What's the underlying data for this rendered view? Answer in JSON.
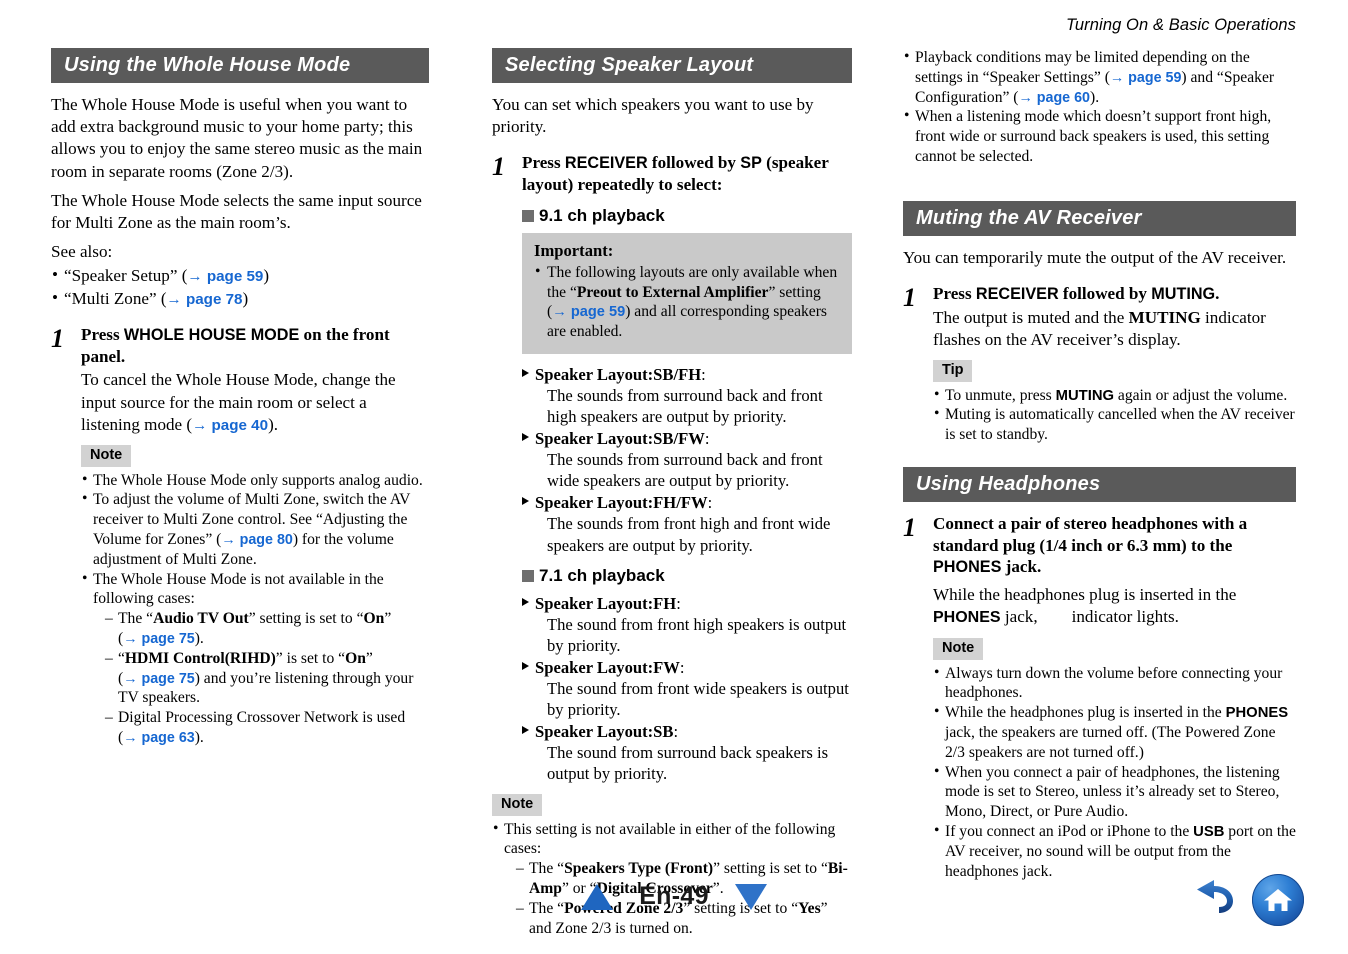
{
  "running_header": "Turning On & Basic Operations",
  "col1": {
    "section_title": "Using the Whole House Mode",
    "intro1": "The Whole House Mode is useful when you want to add extra background music to your home party; this allows you to enjoy the same stereo music as the main room in separate rooms (Zone 2/3).",
    "intro2": "The Whole House Mode selects the same input source for Multi Zone as the main room’s.",
    "see_also_label": "See also:",
    "see_also": [
      {
        "pre": "“Speaker Setup” (",
        "link": "→ page 59",
        "post": ")"
      },
      {
        "pre": "“Multi Zone” (",
        "link": "→ page 78",
        "post": ")"
      }
    ],
    "step": {
      "num": "1",
      "title_pre": "Press ",
      "title_caps": "WHOLE HOUSE MODE",
      "title_post": " on the front panel.",
      "desc_pre": "To cancel the Whole House Mode, change the input source for the main room or select a listening mode (",
      "desc_link": "→ page 40",
      "desc_post": ")."
    },
    "note_badge": "Note",
    "notes": {
      "n1": "The Whole House Mode only supports analog audio.",
      "n2_a": "To adjust the volume of Multi Zone, switch the AV receiver to Multi Zone control. See “Adjusting the Volume for Zones” (",
      "n2_link": "→ page 80",
      "n2_b": ") for the volume adjustment of Multi Zone.",
      "n3": "The Whole House Mode is not available in the following cases:",
      "sub1_a": "The “",
      "sub1_b": "Audio TV Out",
      "sub1_c": "” setting is set to “",
      "sub1_d": "On",
      "sub1_e": "” (",
      "sub1_link": "→ page 75",
      "sub1_f": ").",
      "sub2_a": "“",
      "sub2_b": "HDMI Control(RIHD)",
      "sub2_c": "” is set to “",
      "sub2_d": "On",
      "sub2_e": "” (",
      "sub2_link": "→ page 75",
      "sub2_f": ") and you’re listening through your TV speakers.",
      "sub3_a": "Digital Processing Crossover Network is used (",
      "sub3_link": "→ page 63",
      "sub3_b": ")."
    }
  },
  "col2": {
    "section_title": "Selecting Speaker Layout",
    "intro": "You can set which speakers you want to use by priority.",
    "step": {
      "num": "1",
      "t1": "Press ",
      "t2": "RECEIVER",
      "t3": " followed by ",
      "t4": "SP",
      "t5": " (speaker layout) repeatedly to select:"
    },
    "head_91": "9.1 ch playback",
    "head_71": "7.1 ch playback",
    "important": {
      "title": "Important:",
      "body_a": "The following layouts are only available when the “",
      "body_b": "Preout to External Amplifier",
      "body_c": "” setting (",
      "link": "→ page 59",
      "body_d": ") and all corresponding speakers are enabled."
    },
    "layouts_91": [
      {
        "head": "Speaker Layout:SB/FH",
        "colon": ":",
        "desc": "The sounds from surround back and front high speakers are output by priority."
      },
      {
        "head": "Speaker Layout:SB/FW",
        "colon": ":",
        "desc": "The sounds from surround back and front wide speakers are output by priority."
      },
      {
        "head": "Speaker Layout:FH/FW",
        "colon": ":",
        "desc": "The sounds from front high and front wide speakers are output by priority."
      }
    ],
    "layouts_71": [
      {
        "head": "Speaker Layout:FH",
        "colon": ":",
        "desc": "The sound from front high speakers is output by priority."
      },
      {
        "head": "Speaker Layout:FW",
        "colon": ":",
        "desc": "The sound from front wide speakers is output by priority."
      },
      {
        "head": "Speaker Layout:SB",
        "colon": ":",
        "desc": "The sound from surround back speakers is output by priority."
      }
    ],
    "note_badge": "Note",
    "note": {
      "n1": "This setting is not available in either of the following cases:",
      "s1_a": "The “",
      "s1_b": "Speakers Type (Front)",
      "s1_c": "” setting is set to “",
      "s1_d": "Bi-Amp",
      "s1_e": "” or “",
      "s1_f": "Digital Crossover",
      "s1_g": "”.",
      "s2_a": "The “",
      "s2_b": "Powered Zone 2/3",
      "s2_c": "” setting is set to “",
      "s2_d": "Yes",
      "s2_e": "” and Zone 2/3 is turned on."
    }
  },
  "col3": {
    "top_notes": {
      "n1_a": "Playback conditions may be limited depending on the settings in “Speaker Settings” (",
      "n1_link1": "→ page 59",
      "n1_b": ") and “Speaker Configuration” (",
      "n1_link2": "→ page 60",
      "n1_c": ").",
      "n2": "When a listening mode which doesn’t support front high, front wide or surround back speakers is used, this setting cannot be selected."
    },
    "muting": {
      "section_title": "Muting the AV Receiver",
      "intro": "You can temporarily mute the output of the AV receiver.",
      "step": {
        "num": "1",
        "t1": "Press ",
        "t2": "RECEIVER",
        "t3": " followed by ",
        "t4": "MUTING",
        "t5": ".",
        "d1": "The output is muted and the ",
        "d2": "MUTING",
        "d3": " indicator flashes on the AV receiver’s display."
      },
      "tip_badge": "Tip",
      "tips": {
        "t1_a": "To unmute, press ",
        "t1_b": "MUTING",
        "t1_c": " again or adjust the volume.",
        "t2": "Muting is automatically cancelled when the AV receiver is set to standby."
      }
    },
    "headphones": {
      "section_title": "Using Headphones",
      "step": {
        "num": "1",
        "t1": "Connect a pair of stereo headphones with a standard plug (1/4 inch or 6.3 mm) to the ",
        "t2": "PHONES",
        "t3": " jack.",
        "d1": "While the headphones plug is inserted in the ",
        "d2": "PHONES",
        "d3": " jack,",
        "d4": "indicator lights."
      },
      "note_badge": "Note",
      "notes": {
        "n1": "Always turn down the volume before connecting your headphones.",
        "n2_a": "While the headphones plug is inserted in the ",
        "n2_b": "PHONES",
        "n2_c": " jack, the speakers are turned off. (The Powered Zone 2/3 speakers are not turned off.)",
        "n3": "When you connect a pair of headphones, the listening mode is set to Stereo, unless it’s already set to Stereo, Mono, Direct, or Pure Audio.",
        "n4_a": "If you connect an iPod or iPhone to the ",
        "n4_b": "USB",
        "n4_c": " port on the AV receiver, no sound will be output from the headphones jack."
      }
    }
  },
  "footer": {
    "page_label": "En-49",
    "prev_icon": "triangle-up-icon",
    "next_icon": "triangle-down-icon",
    "back_icon": "back-arrow-icon",
    "home_icon": "home-icon"
  },
  "colors": {
    "section_bar": "#5a5a5a",
    "link_blue": "#1667d1",
    "badge_gray": "#d2d2d2",
    "important_gray": "#c9c9c9",
    "nav_blue": "#1f66c0"
  }
}
